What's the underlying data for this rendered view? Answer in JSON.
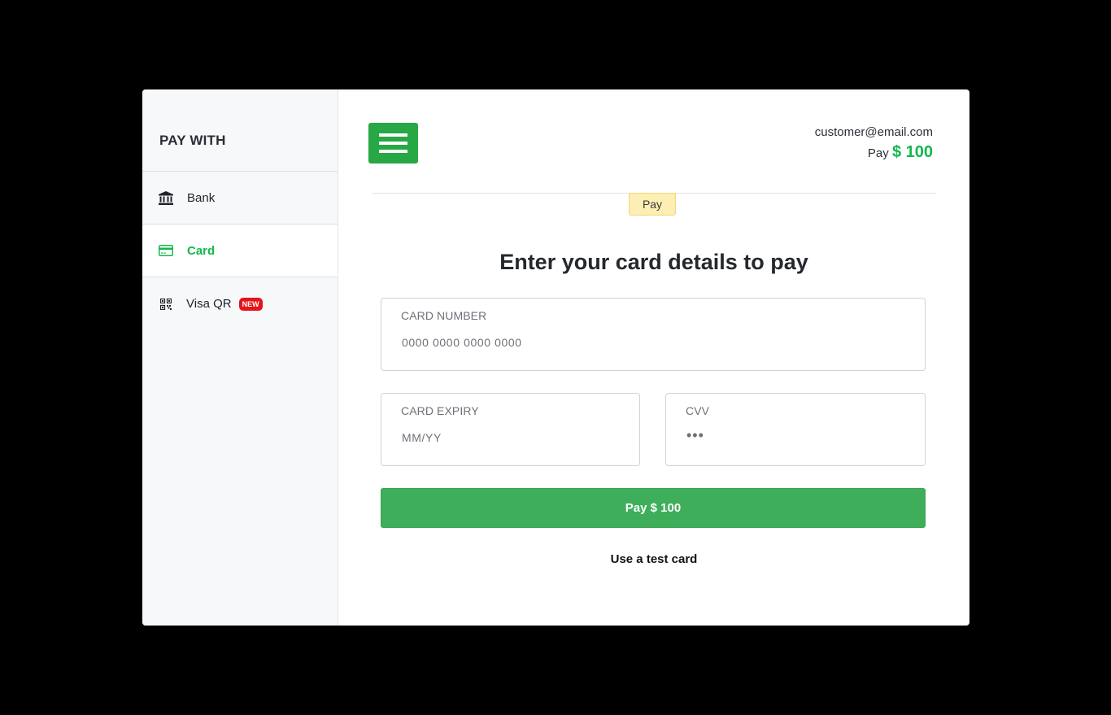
{
  "sidebar": {
    "title": "PAY WITH",
    "items": [
      {
        "label": "Bank",
        "icon": "bank-icon"
      },
      {
        "label": "Card",
        "icon": "credit-card-icon"
      },
      {
        "label": "Visa QR",
        "icon": "qr-code-icon",
        "badge": "NEW"
      }
    ]
  },
  "header": {
    "email": "customer@email.com",
    "pay_prefix": "Pay",
    "amount": "$ 100"
  },
  "tab": {
    "label": "Pay"
  },
  "form": {
    "title": "Enter your card details to pay",
    "card_number": {
      "label": "CARD NUMBER",
      "placeholder": "0000 0000 0000 0000",
      "value": ""
    },
    "card_expiry": {
      "label": "CARD EXPIRY",
      "placeholder": "MM/YY",
      "value": ""
    },
    "cvv": {
      "label": "CVV",
      "placeholder": "•••",
      "value": ""
    },
    "submit_label": "Pay $ 100",
    "test_card_label": "Use a test card"
  },
  "colors": {
    "accent": "#11b84c",
    "button": "#3fae5a",
    "menu_button": "#28a745",
    "badge": "#e5141b",
    "tag_bg": "#fdeeb4"
  }
}
